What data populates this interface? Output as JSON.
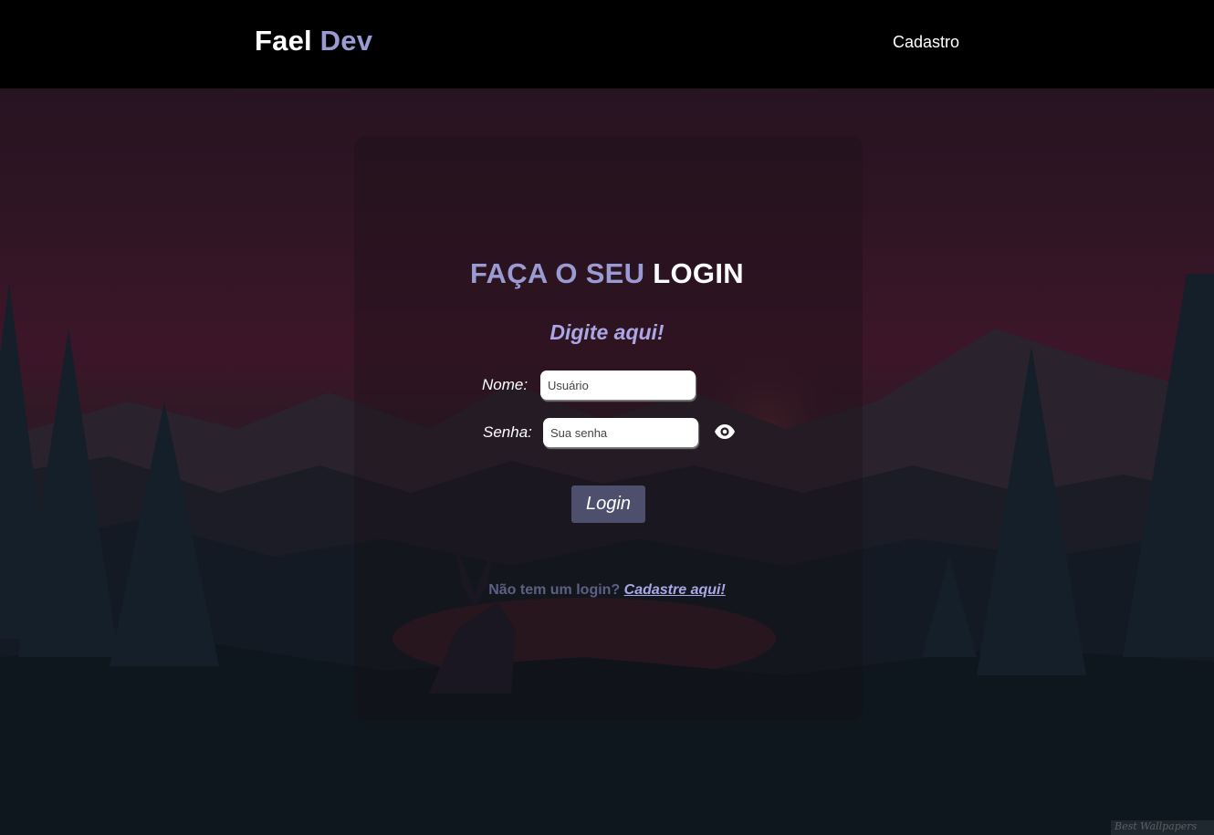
{
  "header": {
    "brand_first": "Fael",
    "brand_second": "Dev",
    "nav_link": "Cadastro"
  },
  "login": {
    "title_part1": "FAÇA O SEU",
    "title_part2": "LOGIN",
    "subtitle": "Digite aqui!",
    "name_label": "Nome:",
    "name_placeholder": "Usuário",
    "password_label": "Senha:",
    "password_placeholder": "Sua senha",
    "show_password_icon": "eye-icon",
    "submit_label": "Login",
    "footer_text": "Não tem um login?",
    "footer_link": "Cadastre aqui!"
  },
  "watermark": "Best Wallpapers",
  "colors": {
    "accent": "#9b9bd3",
    "subtitle": "#aba7e6",
    "button": "#4d4f6d",
    "header_bg": "#000000"
  }
}
